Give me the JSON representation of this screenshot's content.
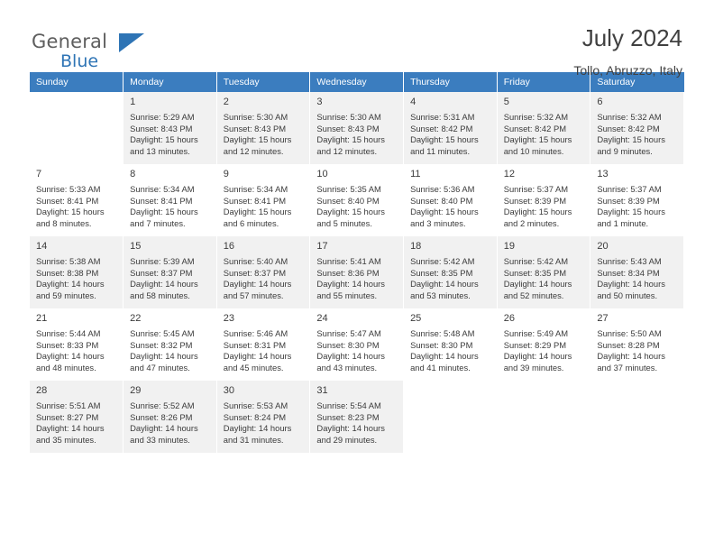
{
  "brand": {
    "word_general": "General",
    "word_blue": "Blue"
  },
  "header": {
    "title": "July 2024",
    "location": "Tollo, Abruzzo, Italy"
  },
  "calendar": {
    "weekdays": [
      "Sunday",
      "Monday",
      "Tuesday",
      "Wednesday",
      "Thursday",
      "Friday",
      "Saturday"
    ],
    "accent_color": "#3b7dbf",
    "shaded_row_color": "#f1f1f1",
    "weeks": [
      [
        {
          "empty": true
        },
        {
          "day": "1",
          "sunrise": "Sunrise: 5:29 AM",
          "sunset": "Sunset: 8:43 PM",
          "daylight1": "Daylight: 15 hours",
          "daylight2": "and 13 minutes."
        },
        {
          "day": "2",
          "sunrise": "Sunrise: 5:30 AM",
          "sunset": "Sunset: 8:43 PM",
          "daylight1": "Daylight: 15 hours",
          "daylight2": "and 12 minutes."
        },
        {
          "day": "3",
          "sunrise": "Sunrise: 5:30 AM",
          "sunset": "Sunset: 8:43 PM",
          "daylight1": "Daylight: 15 hours",
          "daylight2": "and 12 minutes."
        },
        {
          "day": "4",
          "sunrise": "Sunrise: 5:31 AM",
          "sunset": "Sunset: 8:42 PM",
          "daylight1": "Daylight: 15 hours",
          "daylight2": "and 11 minutes."
        },
        {
          "day": "5",
          "sunrise": "Sunrise: 5:32 AM",
          "sunset": "Sunset: 8:42 PM",
          "daylight1": "Daylight: 15 hours",
          "daylight2": "and 10 minutes."
        },
        {
          "day": "6",
          "sunrise": "Sunrise: 5:32 AM",
          "sunset": "Sunset: 8:42 PM",
          "daylight1": "Daylight: 15 hours",
          "daylight2": "and 9 minutes."
        }
      ],
      [
        {
          "day": "7",
          "sunrise": "Sunrise: 5:33 AM",
          "sunset": "Sunset: 8:41 PM",
          "daylight1": "Daylight: 15 hours",
          "daylight2": "and 8 minutes."
        },
        {
          "day": "8",
          "sunrise": "Sunrise: 5:34 AM",
          "sunset": "Sunset: 8:41 PM",
          "daylight1": "Daylight: 15 hours",
          "daylight2": "and 7 minutes."
        },
        {
          "day": "9",
          "sunrise": "Sunrise: 5:34 AM",
          "sunset": "Sunset: 8:41 PM",
          "daylight1": "Daylight: 15 hours",
          "daylight2": "and 6 minutes."
        },
        {
          "day": "10",
          "sunrise": "Sunrise: 5:35 AM",
          "sunset": "Sunset: 8:40 PM",
          "daylight1": "Daylight: 15 hours",
          "daylight2": "and 5 minutes."
        },
        {
          "day": "11",
          "sunrise": "Sunrise: 5:36 AM",
          "sunset": "Sunset: 8:40 PM",
          "daylight1": "Daylight: 15 hours",
          "daylight2": "and 3 minutes."
        },
        {
          "day": "12",
          "sunrise": "Sunrise: 5:37 AM",
          "sunset": "Sunset: 8:39 PM",
          "daylight1": "Daylight: 15 hours",
          "daylight2": "and 2 minutes."
        },
        {
          "day": "13",
          "sunrise": "Sunrise: 5:37 AM",
          "sunset": "Sunset: 8:39 PM",
          "daylight1": "Daylight: 15 hours",
          "daylight2": "and 1 minute."
        }
      ],
      [
        {
          "day": "14",
          "sunrise": "Sunrise: 5:38 AM",
          "sunset": "Sunset: 8:38 PM",
          "daylight1": "Daylight: 14 hours",
          "daylight2": "and 59 minutes."
        },
        {
          "day": "15",
          "sunrise": "Sunrise: 5:39 AM",
          "sunset": "Sunset: 8:37 PM",
          "daylight1": "Daylight: 14 hours",
          "daylight2": "and 58 minutes."
        },
        {
          "day": "16",
          "sunrise": "Sunrise: 5:40 AM",
          "sunset": "Sunset: 8:37 PM",
          "daylight1": "Daylight: 14 hours",
          "daylight2": "and 57 minutes."
        },
        {
          "day": "17",
          "sunrise": "Sunrise: 5:41 AM",
          "sunset": "Sunset: 8:36 PM",
          "daylight1": "Daylight: 14 hours",
          "daylight2": "and 55 minutes."
        },
        {
          "day": "18",
          "sunrise": "Sunrise: 5:42 AM",
          "sunset": "Sunset: 8:35 PM",
          "daylight1": "Daylight: 14 hours",
          "daylight2": "and 53 minutes."
        },
        {
          "day": "19",
          "sunrise": "Sunrise: 5:42 AM",
          "sunset": "Sunset: 8:35 PM",
          "daylight1": "Daylight: 14 hours",
          "daylight2": "and 52 minutes."
        },
        {
          "day": "20",
          "sunrise": "Sunrise: 5:43 AM",
          "sunset": "Sunset: 8:34 PM",
          "daylight1": "Daylight: 14 hours",
          "daylight2": "and 50 minutes."
        }
      ],
      [
        {
          "day": "21",
          "sunrise": "Sunrise: 5:44 AM",
          "sunset": "Sunset: 8:33 PM",
          "daylight1": "Daylight: 14 hours",
          "daylight2": "and 48 minutes."
        },
        {
          "day": "22",
          "sunrise": "Sunrise: 5:45 AM",
          "sunset": "Sunset: 8:32 PM",
          "daylight1": "Daylight: 14 hours",
          "daylight2": "and 47 minutes."
        },
        {
          "day": "23",
          "sunrise": "Sunrise: 5:46 AM",
          "sunset": "Sunset: 8:31 PM",
          "daylight1": "Daylight: 14 hours",
          "daylight2": "and 45 minutes."
        },
        {
          "day": "24",
          "sunrise": "Sunrise: 5:47 AM",
          "sunset": "Sunset: 8:30 PM",
          "daylight1": "Daylight: 14 hours",
          "daylight2": "and 43 minutes."
        },
        {
          "day": "25",
          "sunrise": "Sunrise: 5:48 AM",
          "sunset": "Sunset: 8:30 PM",
          "daylight1": "Daylight: 14 hours",
          "daylight2": "and 41 minutes."
        },
        {
          "day": "26",
          "sunrise": "Sunrise: 5:49 AM",
          "sunset": "Sunset: 8:29 PM",
          "daylight1": "Daylight: 14 hours",
          "daylight2": "and 39 minutes."
        },
        {
          "day": "27",
          "sunrise": "Sunrise: 5:50 AM",
          "sunset": "Sunset: 8:28 PM",
          "daylight1": "Daylight: 14 hours",
          "daylight2": "and 37 minutes."
        }
      ],
      [
        {
          "day": "28",
          "sunrise": "Sunrise: 5:51 AM",
          "sunset": "Sunset: 8:27 PM",
          "daylight1": "Daylight: 14 hours",
          "daylight2": "and 35 minutes."
        },
        {
          "day": "29",
          "sunrise": "Sunrise: 5:52 AM",
          "sunset": "Sunset: 8:26 PM",
          "daylight1": "Daylight: 14 hours",
          "daylight2": "and 33 minutes."
        },
        {
          "day": "30",
          "sunrise": "Sunrise: 5:53 AM",
          "sunset": "Sunset: 8:24 PM",
          "daylight1": "Daylight: 14 hours",
          "daylight2": "and 31 minutes."
        },
        {
          "day": "31",
          "sunrise": "Sunrise: 5:54 AM",
          "sunset": "Sunset: 8:23 PM",
          "daylight1": "Daylight: 14 hours",
          "daylight2": "and 29 minutes."
        },
        {
          "empty": true
        },
        {
          "empty": true
        },
        {
          "empty": true
        }
      ]
    ]
  }
}
